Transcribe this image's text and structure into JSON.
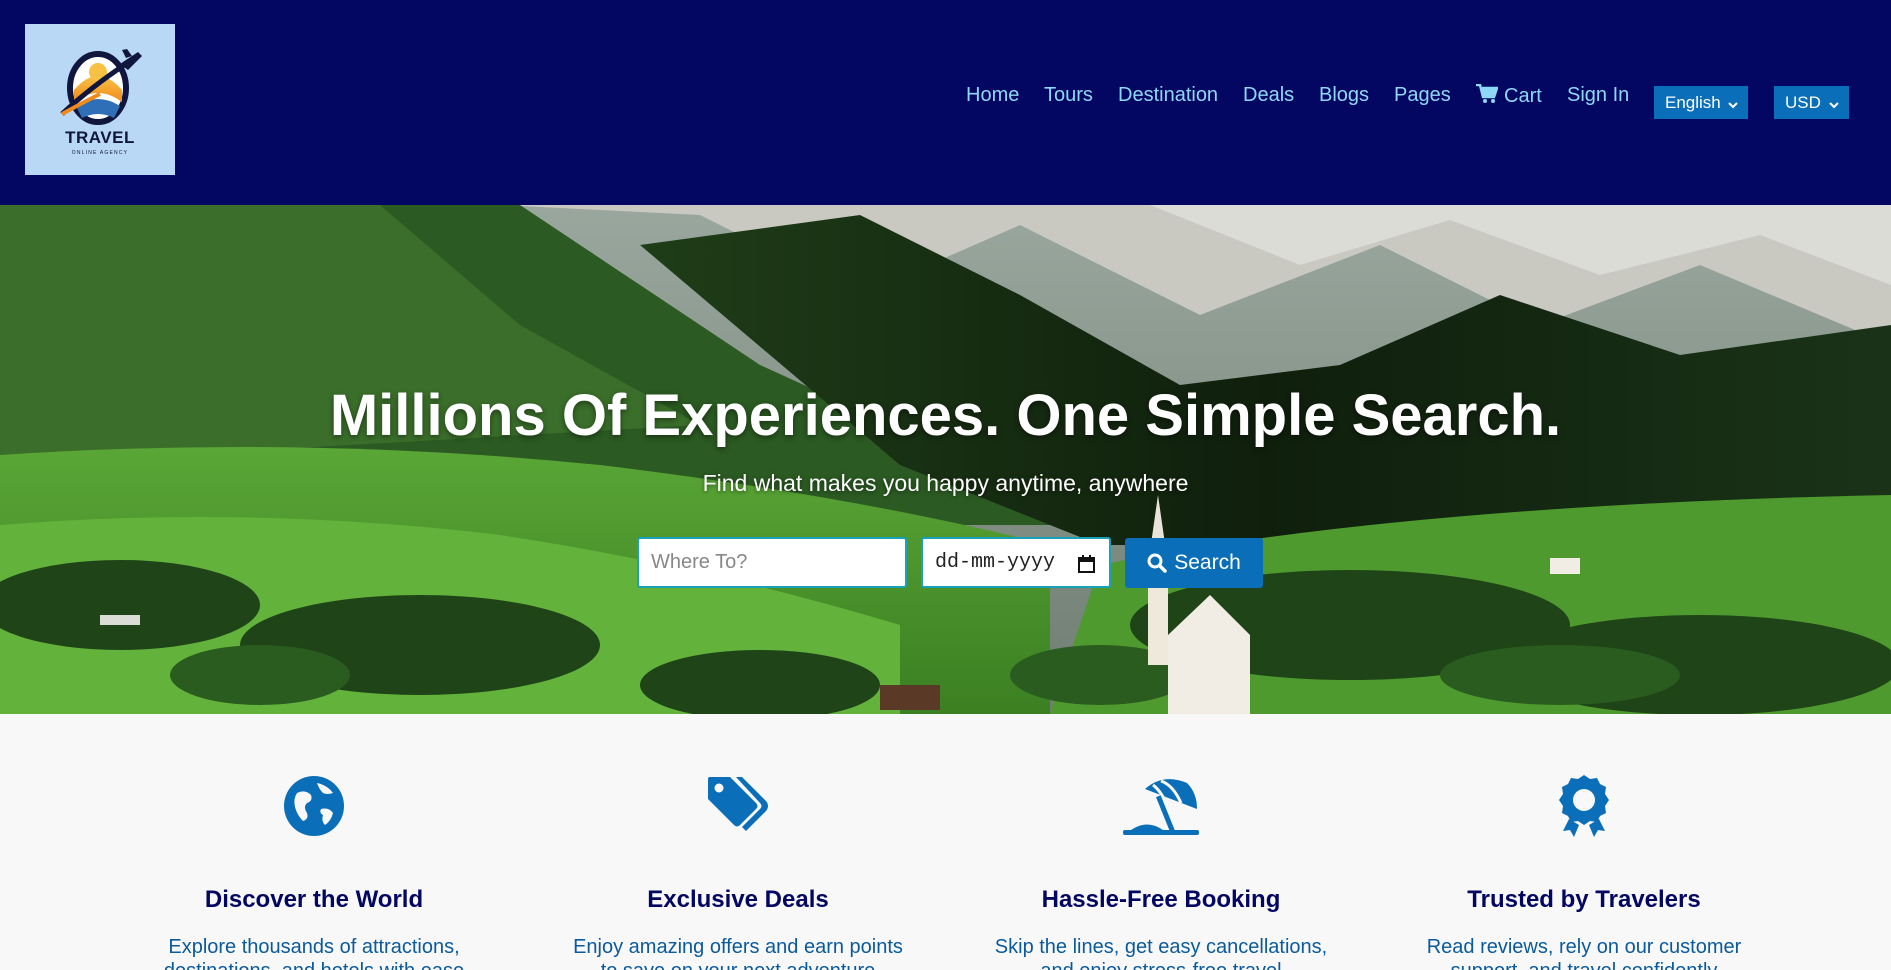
{
  "brand": {
    "logo_text": "TRAVEL",
    "logo_subtext": "ONLINE AGENCY"
  },
  "nav": {
    "items": [
      "Home",
      "Tours",
      "Destination",
      "Deals",
      "Blogs",
      "Pages"
    ],
    "cart_label": "Cart",
    "cart_icon": "cart-icon",
    "signin_label": "Sign In",
    "language": "English",
    "currency": "USD"
  },
  "hero": {
    "title": "Millions Of Experiences. One Simple Search.",
    "subtitle": "Find what makes you happy anytime, anywhere",
    "where_placeholder": "Where To?",
    "date_placeholder": "dd-mm-yyyy",
    "search_label": "Search",
    "search_icon": "search-icon"
  },
  "features": [
    {
      "icon": "globe-icon",
      "title": "Discover the World",
      "text": "Explore thousands of attractions, destinations, and hotels with ease"
    },
    {
      "icon": "tags-icon",
      "title": "Exclusive Deals",
      "text": "Enjoy amazing offers and earn points to save on your next adventure"
    },
    {
      "icon": "umbrella-beach-icon",
      "title": "Hassle-Free Booking",
      "text": "Skip the lines, get easy cancellations, and enjoy stress-free travel"
    },
    {
      "icon": "award-icon",
      "title": "Trusted by Travelers",
      "text": "Read reviews, rely on our customer support, and travel confidently"
    }
  ],
  "colors": {
    "header_bg": "#030762",
    "nav_link": "#8fd7f6",
    "accent": "#0a6fb8",
    "feature_title": "#030762",
    "feature_text": "#0a5a9c"
  }
}
